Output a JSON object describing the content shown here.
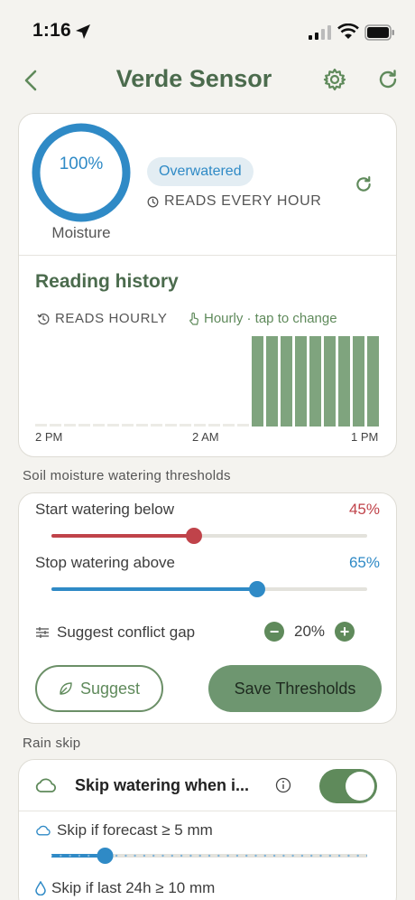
{
  "status_bar": {
    "time": "1:16"
  },
  "header": {
    "title": "Verde Sensor"
  },
  "sensor": {
    "moisture_percent": "100%",
    "moisture_label": "Moisture",
    "status_badge": "Overwatered",
    "reads_interval": "READS EVERY HOUR"
  },
  "history": {
    "title": "Reading history",
    "reads_label": "READS HOURLY",
    "change_hint": "Hourly · tap to change"
  },
  "chart_data": {
    "type": "bar",
    "title": "Reading history",
    "x_tick_labels": [
      "2 PM",
      "2 AM",
      "1 PM"
    ],
    "bar_count": 24,
    "values": [
      0,
      0,
      0,
      0,
      0,
      0,
      0,
      0,
      0,
      0,
      0,
      0,
      0,
      0,
      0,
      100,
      100,
      100,
      100,
      100,
      100,
      100,
      100,
      100
    ],
    "ylim": [
      0,
      100
    ],
    "colors": {
      "bar": "#7fa47e",
      "empty": "#ecebe6"
    }
  },
  "thresholds": {
    "section_label": "Soil moisture watering thresholds",
    "start_label": "Start watering below",
    "start_value": "45%",
    "start_fraction": 0.45,
    "stop_label": "Stop watering above",
    "stop_value": "65%",
    "stop_fraction": 0.65,
    "gap_label": "Suggest conflict gap",
    "gap_value": "20%",
    "suggest_label": "Suggest",
    "save_label": "Save Thresholds",
    "colors": {
      "start": "#c0434a",
      "stop": "#2f8ac6"
    }
  },
  "rain_skip": {
    "section_label": "Rain skip",
    "toggle_label": "Skip watering when i...",
    "toggle_on": true,
    "forecast_label": "Skip if forecast ≥ 5 mm",
    "forecast_fraction": 0.17,
    "last24_label": "Skip if last 24h ≥ 10 mm"
  },
  "colors": {
    "accent_green": "#5f8a5b",
    "accent_blue": "#2f8ac6",
    "background": "#f4f3ef"
  }
}
